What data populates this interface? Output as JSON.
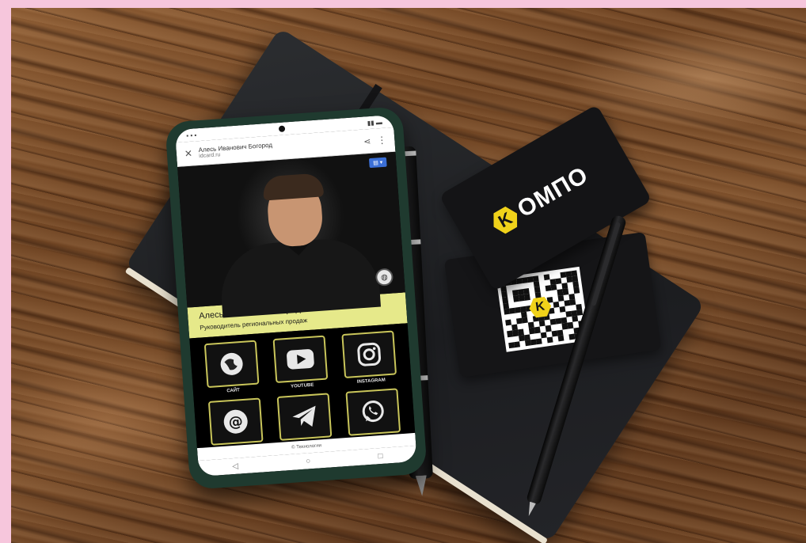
{
  "browser": {
    "page_title": "Алесь Иванович Богород",
    "domain": "idcard.ru"
  },
  "profile": {
    "name": "Алесь Иванович Богородь",
    "role": "Руководитель региональных продаж"
  },
  "links": [
    {
      "icon": "globe-icon",
      "label": "САЙТ"
    },
    {
      "icon": "youtube-icon",
      "label": "YOUTUBE"
    },
    {
      "icon": "instagram-icon",
      "label": "INSTAGRAM"
    },
    {
      "icon": "email-icon",
      "label": ""
    },
    {
      "icon": "telegram-icon",
      "label": ""
    },
    {
      "icon": "whatsapp-icon",
      "label": ""
    }
  ],
  "footer": {
    "text": "© Технологии"
  },
  "brand_card": {
    "logo_letter": "K",
    "brand_text": "ОМПО"
  },
  "qr_card": {
    "logo_letter": "K"
  },
  "colors": {
    "accent_yellow": "#f0d21a",
    "name_bar": "#e6e98a",
    "tile_border": "#c9c55a"
  }
}
